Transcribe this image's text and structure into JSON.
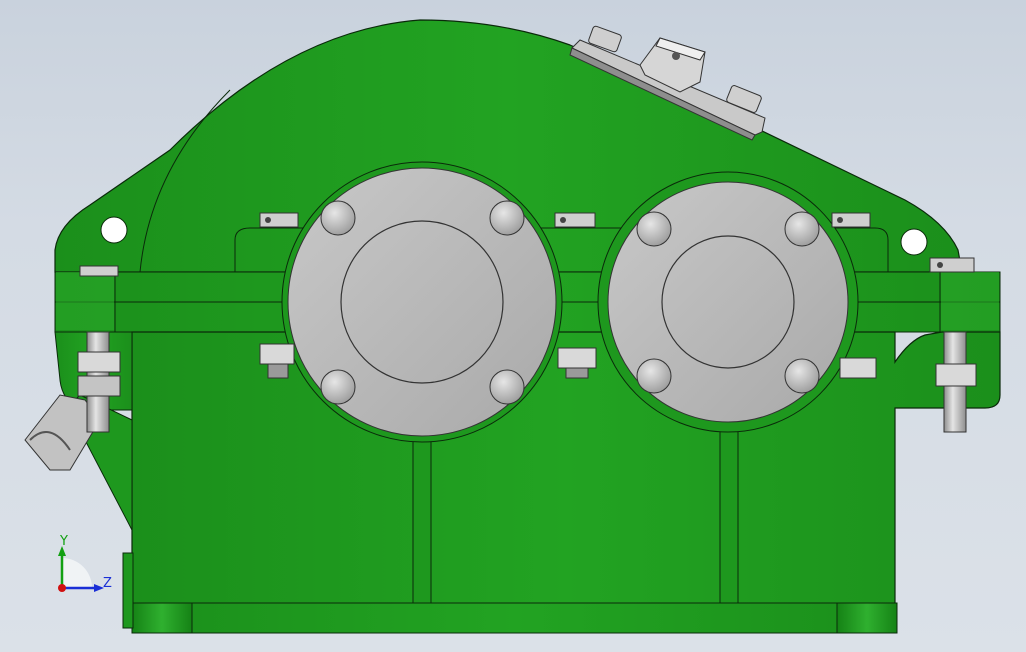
{
  "viewport": {
    "background": "#d3dae3",
    "model": {
      "housing_color": "#1f9b1f",
      "housing_shade": "#17801a",
      "edge_color": "#0a2a0a",
      "metal_color": "#b5b5b5",
      "metal_light": "#d8d8d8"
    }
  },
  "triad": {
    "y_label": "Y",
    "z_label": "Z",
    "y_color": "#12a012",
    "z_color": "#1a2fd6",
    "origin_color": "#d01010"
  }
}
